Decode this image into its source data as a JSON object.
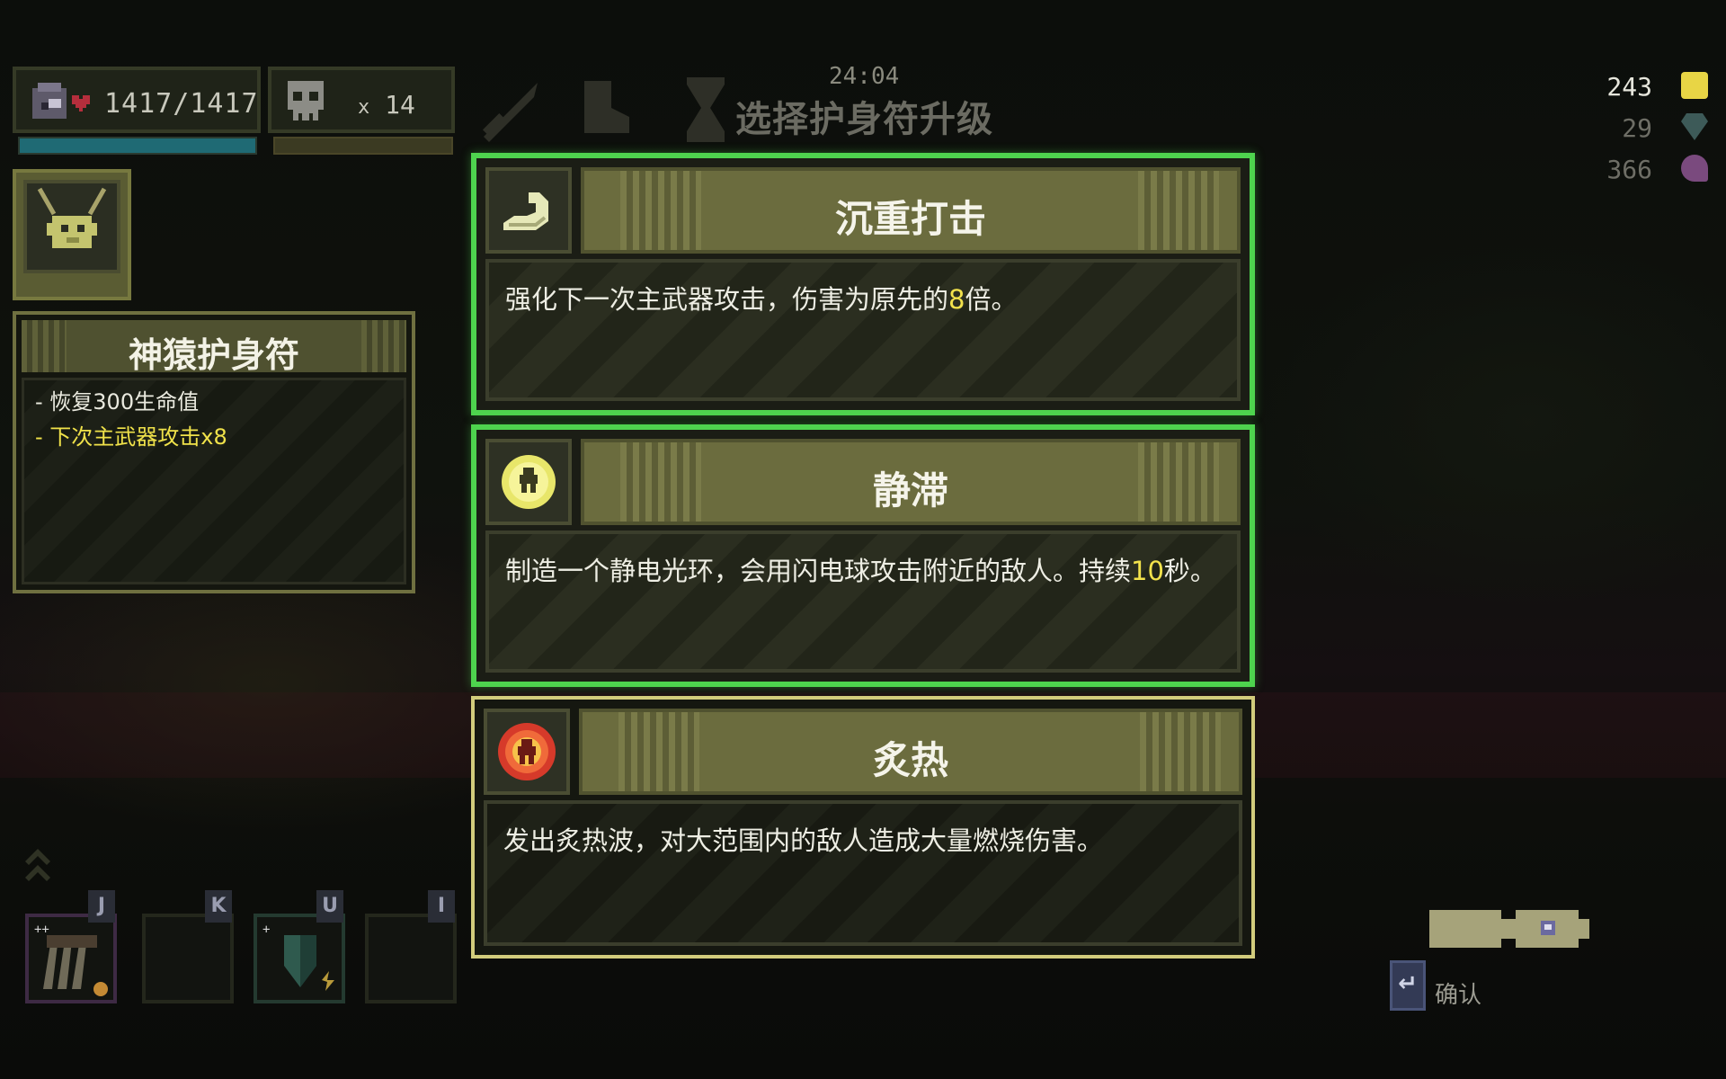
{
  "hud": {
    "health": "1417/1417",
    "health_fraction": 1.0,
    "kill_prefix": "x",
    "kill_count": "14"
  },
  "header": {
    "timer": "24:04",
    "title": "选择护身符升级"
  },
  "currency": {
    "gold": "243",
    "gems": "29",
    "souls": "366",
    "gold_color": "#e8d545",
    "gem_color": "#3d5a58",
    "soul_color": "#7a4a7e"
  },
  "amulet_tooltip": {
    "title": "神猿护身符",
    "lines": [
      "- 恢复300生命值",
      "- 下次主武器攻击x8"
    ]
  },
  "choices": [
    {
      "title": "沉重打击",
      "desc_before": "强化下一次主武器攻击，伤害为原先的",
      "desc_num": "8",
      "desc_after": "倍。",
      "icon": "flexed-arm-icon",
      "selected": true
    },
    {
      "title": "静滞",
      "desc_before": "制造一个静电光环，会用闪电球攻击附近的敌人。持续",
      "desc_num": "10",
      "desc_after": "秒。",
      "icon": "static-aura-icon",
      "selected": true
    },
    {
      "title": "炙热",
      "desc_before": "发出炙热波，对大范围内的敌人造成大量燃烧伤害。",
      "desc_num": "",
      "desc_after": "",
      "icon": "heat-burst-icon",
      "selected": false
    }
  ],
  "skill_keys": [
    "J",
    "K",
    "U",
    "I"
  ],
  "confirm": {
    "key": "↵",
    "label": "确认"
  },
  "colors": {
    "selected_border": "#4ed34e",
    "normal_border": "#d2cc7c",
    "highlight_number": "#f2e24c"
  }
}
